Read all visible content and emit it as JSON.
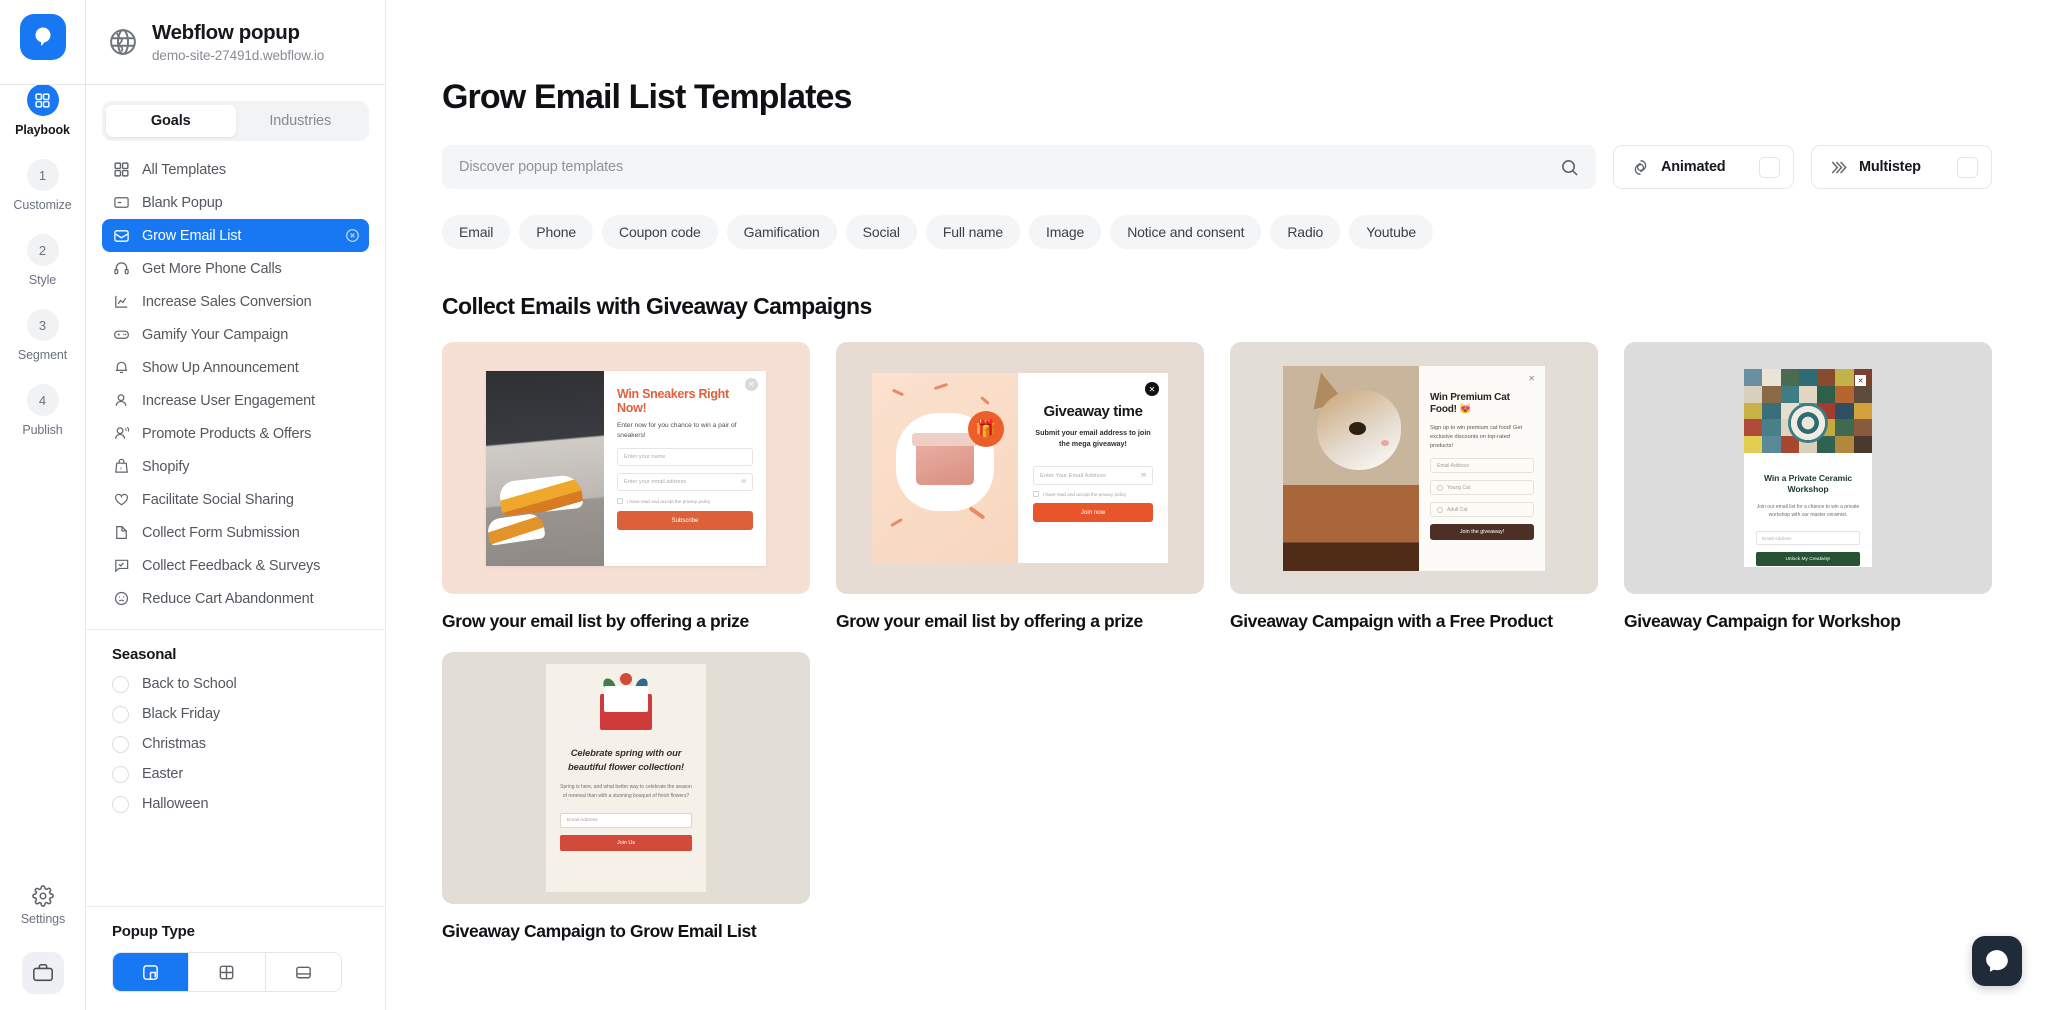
{
  "rail": {
    "logo_icon": "popupsmart-logo-icon",
    "steps": [
      {
        "badge": "",
        "label": "Playbook",
        "icon": "grid-icon",
        "active": true
      },
      {
        "badge": "1",
        "label": "Customize",
        "icon": "",
        "active": false
      },
      {
        "badge": "2",
        "label": "Style",
        "icon": "",
        "active": false
      },
      {
        "badge": "3",
        "label": "Segment",
        "icon": "",
        "active": false
      },
      {
        "badge": "4",
        "label": "Publish",
        "icon": "",
        "active": false
      }
    ],
    "settings_label": "Settings",
    "settings_icon": "gear-icon",
    "avatar_icon": "briefcase-icon"
  },
  "site": {
    "icon": "globe-icon",
    "title": "Webflow popup",
    "url": "demo-site-27491d.webflow.io"
  },
  "tabs": [
    {
      "label": "Goals",
      "active": true
    },
    {
      "label": "Industries",
      "active": false
    }
  ],
  "nav": [
    {
      "label": "All Templates",
      "icon": "grid-icon",
      "active": false
    },
    {
      "label": "Blank Popup",
      "icon": "blank-popup-icon",
      "active": false
    },
    {
      "label": "Grow Email List",
      "icon": "envelope-icon",
      "active": true
    },
    {
      "label": "Get More Phone Calls",
      "icon": "headset-icon",
      "active": false
    },
    {
      "label": "Increase Sales Conversion",
      "icon": "chart-line-icon",
      "active": false
    },
    {
      "label": "Gamify Your Campaign",
      "icon": "gamepad-icon",
      "active": false
    },
    {
      "label": "Show Up Announcement",
      "icon": "bell-icon",
      "active": false
    },
    {
      "label": "Increase User Engagement",
      "icon": "user-icon",
      "active": false
    },
    {
      "label": "Promote Products & Offers",
      "icon": "user-speaking-icon",
      "active": false
    },
    {
      "label": "Shopify",
      "icon": "shopify-bag-icon",
      "active": false
    },
    {
      "label": "Facilitate Social Sharing",
      "icon": "heart-icon",
      "active": false
    },
    {
      "label": "Collect Form Submission",
      "icon": "document-icon",
      "active": false
    },
    {
      "label": "Collect Feedback & Surveys",
      "icon": "chat-check-icon",
      "active": false
    },
    {
      "label": "Reduce Cart Abandonment",
      "icon": "sad-face-icon",
      "active": false
    }
  ],
  "seasonal": {
    "title": "Seasonal",
    "items": [
      {
        "label": "Back to School"
      },
      {
        "label": "Black Friday"
      },
      {
        "label": "Christmas"
      },
      {
        "label": "Easter"
      },
      {
        "label": "Halloween"
      }
    ]
  },
  "popup_type": {
    "title": "Popup Type",
    "options": [
      {
        "icon": "popup-modal-icon",
        "active": true
      },
      {
        "icon": "fullscreen-icon",
        "active": false
      },
      {
        "icon": "bar-icon",
        "active": false
      }
    ]
  },
  "main": {
    "page_title": "Grow Email List Templates",
    "search": {
      "placeholder": "Discover popup templates",
      "value": "",
      "icon": "search-icon"
    },
    "toggles": [
      {
        "label": "Animated",
        "icon": "animated-icon",
        "checked": false
      },
      {
        "label": "Multistep",
        "icon": "multistep-icon",
        "checked": false
      }
    ],
    "chips": [
      "Email",
      "Phone",
      "Coupon code",
      "Gamification",
      "Social",
      "Full name",
      "Image",
      "Notice and consent",
      "Radio",
      "Youtube"
    ],
    "section_heading": "Collect Emails with Giveaway Campaigns",
    "cards": [
      {
        "title": "Grow your email list by offering a prize",
        "popup": {
          "heading": "Win Sneakers Right Now!",
          "body": "Enter now for you chance to win a pair of sneakers!",
          "name_field": "Enter your name",
          "email_field": "Enter your email address",
          "consent": "I have read and accept the privacy policy",
          "cta": "Subscribe",
          "close_icon": "close-icon"
        }
      },
      {
        "title": "Grow your email list by offering a prize",
        "popup": {
          "heading": "Giveaway time",
          "body": "Submit your email address to join the mega giveaway!",
          "email_field": "Enter Your Email Address",
          "consent": "I have read and accept the privacy policy",
          "cta": "Join now",
          "close_icon": "close-icon",
          "gift_icon": "gift-icon"
        }
      },
      {
        "title": "Giveaway Campaign with a Free Product",
        "popup": {
          "heading": "Win Premium Cat Food! 😻",
          "body": "Sign up to win premium cat food! Get exclusive discounts on top-rated products!",
          "email_field": "Email Address",
          "option_1": "Young Cat",
          "option_2": "Adult Cat",
          "cta": "Join the giveaway!",
          "close_icon": "close-icon"
        }
      },
      {
        "title": "Giveaway Campaign for Workshop",
        "popup": {
          "heading": "Win a Private Ceramic Workshop",
          "body": "Join our email list for a chance to win a private workshop with our master ceramist.",
          "email_field": "Email Address",
          "cta": "Unlock My Creativity!",
          "close_icon": "close-icon"
        }
      },
      {
        "title": "Giveaway Campaign to Grow Email List",
        "popup": {
          "heading": "Celebrate spring with our beautiful flower collection!",
          "body": "Spring is here, and what better way to celebrate the season of renewal than with a stunning bouquet of fresh flowers?",
          "email_field": "Email Address",
          "cta": "Join Us"
        }
      }
    ]
  },
  "chat": {
    "icon": "chat-bubble-icon"
  },
  "colors": {
    "accent": "#1877f2",
    "text": "#16181d",
    "muted": "#868b93",
    "chip_bg": "#f4f5f7"
  }
}
